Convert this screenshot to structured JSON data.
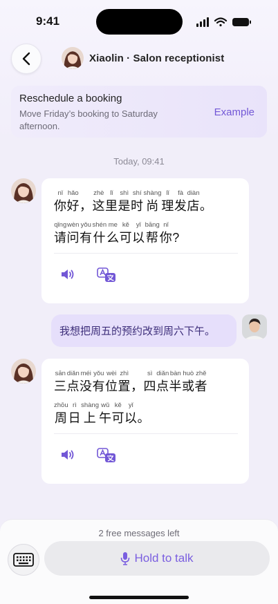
{
  "status": {
    "time": "9:41"
  },
  "header": {
    "title": "Xiaolin · Salon receptionist"
  },
  "task": {
    "title": "Reschedule a booking",
    "description": "Move Friday’s booking to Saturday afternoon.",
    "example_label": "Example"
  },
  "chat": {
    "timestamp": "Today, 09:41",
    "messages": [
      {
        "lines": [
          [
            {
              "py": "nǐ",
              "hz": "你"
            },
            {
              "py": "hǎo",
              "hz": "好"
            },
            {
              "py": "",
              "hz": "，"
            },
            {
              "py": "zhè",
              "hz": "这"
            },
            {
              "py": "lǐ",
              "hz": "里"
            },
            {
              "py": "shì",
              "hz": "是"
            },
            {
              "py": "shí",
              "hz": "时"
            },
            {
              "py": "shàng",
              "hz": "尚"
            },
            {
              "py": "lǐ",
              "hz": "理"
            },
            {
              "py": "fà",
              "hz": "发"
            },
            {
              "py": "diàn",
              "hz": "店"
            },
            {
              "py": "",
              "hz": "。"
            }
          ],
          [
            {
              "py": "qǐng",
              "hz": "请"
            },
            {
              "py": "wèn",
              "hz": "问"
            },
            {
              "py": "yǒu",
              "hz": "有"
            },
            {
              "py": "shén",
              "hz": "什"
            },
            {
              "py": "me",
              "hz": "么"
            },
            {
              "py": "kě",
              "hz": "可"
            },
            {
              "py": "yǐ",
              "hz": "以"
            },
            {
              "py": "bāng",
              "hz": "帮"
            },
            {
              "py": "nǐ",
              "hz": "你"
            },
            {
              "py": "",
              "hz": "?"
            }
          ]
        ]
      },
      {
        "lines": [
          [
            {
              "py": "sān",
              "hz": "三"
            },
            {
              "py": "diǎn",
              "hz": "点"
            },
            {
              "py": "méi",
              "hz": "没"
            },
            {
              "py": "yǒu",
              "hz": "有"
            },
            {
              "py": "wèi",
              "hz": "位"
            },
            {
              "py": "zhì",
              "hz": "置"
            },
            {
              "py": "",
              "hz": "，"
            },
            {
              "py": "sì",
              "hz": "四"
            },
            {
              "py": "diǎn",
              "hz": "点"
            },
            {
              "py": "bàn",
              "hz": "半"
            },
            {
              "py": "huò",
              "hz": "或"
            },
            {
              "py": "zhě",
              "hz": "者"
            }
          ],
          [
            {
              "py": "zhōu",
              "hz": "周"
            },
            {
              "py": "rì",
              "hz": "日"
            },
            {
              "py": "shàng",
              "hz": "上"
            },
            {
              "py": "wǔ",
              "hz": "午"
            },
            {
              "py": "kě",
              "hz": "可"
            },
            {
              "py": "yǐ",
              "hz": "以"
            },
            {
              "py": "",
              "hz": "。"
            }
          ]
        ]
      }
    ],
    "user_message": "我想把周五的预约改到周六下午。"
  },
  "footer": {
    "free_messages": "2 free messages left",
    "hold_label": "Hold to talk"
  },
  "colors": {
    "accent": "#7257d6",
    "user_bubble": "#e6dffb"
  }
}
